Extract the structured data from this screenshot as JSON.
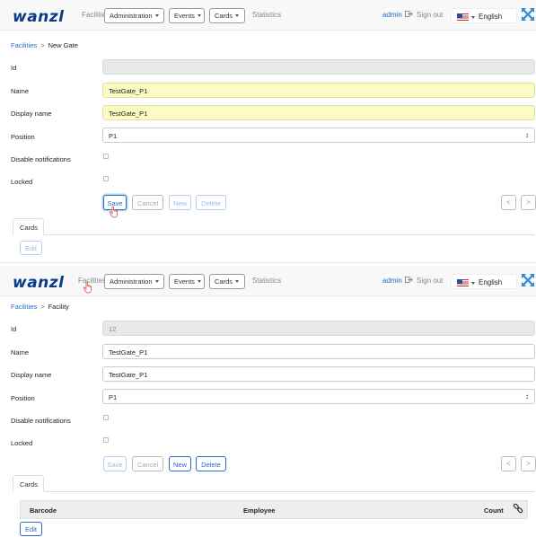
{
  "nav": {
    "logo": "wanzl",
    "facilities": "Facilities",
    "administration": "Administration",
    "events": "Events",
    "cards": "Cards",
    "statistics": "Statistics",
    "user": "admin",
    "sign_out": "Sign out",
    "language": "English"
  },
  "panel1": {
    "breadcrumb": {
      "root": "Facilities",
      "separator": ">",
      "current": "New Gate"
    },
    "fields": {
      "id_label": "Id",
      "id_value": "",
      "name_label": "Name",
      "name_value": "TestGate_P1",
      "display_label": "Display name",
      "display_value": "TestGate_P1",
      "position_label": "Position",
      "position_value": "P1",
      "disable_label": "Disable notifications",
      "locked_label": "Locked"
    },
    "buttons": {
      "save": "Save",
      "cancel": "Cancel",
      "new": "New",
      "delete": "Delete",
      "prev": "<",
      "next": ">"
    },
    "tab": "Cards",
    "edit": "Edit"
  },
  "panel2": {
    "breadcrumb": {
      "root": "Facilities",
      "separator": ">",
      "current": "Facility"
    },
    "fields": {
      "id_label": "Id",
      "id_value": "12",
      "name_label": "Name",
      "name_value": "TestGate_P1",
      "display_label": "Display name",
      "display_value": "TestGate_P1",
      "position_label": "Position",
      "position_value": "P1",
      "disable_label": "Disable notifications",
      "locked_label": "Locked"
    },
    "buttons": {
      "save": "Save",
      "cancel": "Cancel",
      "new": "New",
      "delete": "Delete",
      "prev": "<",
      "next": ">"
    },
    "tab": "Cards",
    "table": {
      "columns": [
        "Barcode",
        "Employee",
        "Count"
      ]
    },
    "edit": "Edit"
  },
  "icons": {
    "signout": "sign-out-icon",
    "flag": "us-flag-icon",
    "expand": "expand-arrows-icon",
    "link": "link-icon",
    "cursor": "hand-pointer-icon"
  },
  "colors": {
    "brand": "#0a3a8c",
    "link": "#2a6ac8",
    "highlight_field": "#fdfbc4",
    "readonly_field": "#e6e8ea",
    "expand_icon": "#2a8ad8",
    "cursor": "#d9534f"
  }
}
